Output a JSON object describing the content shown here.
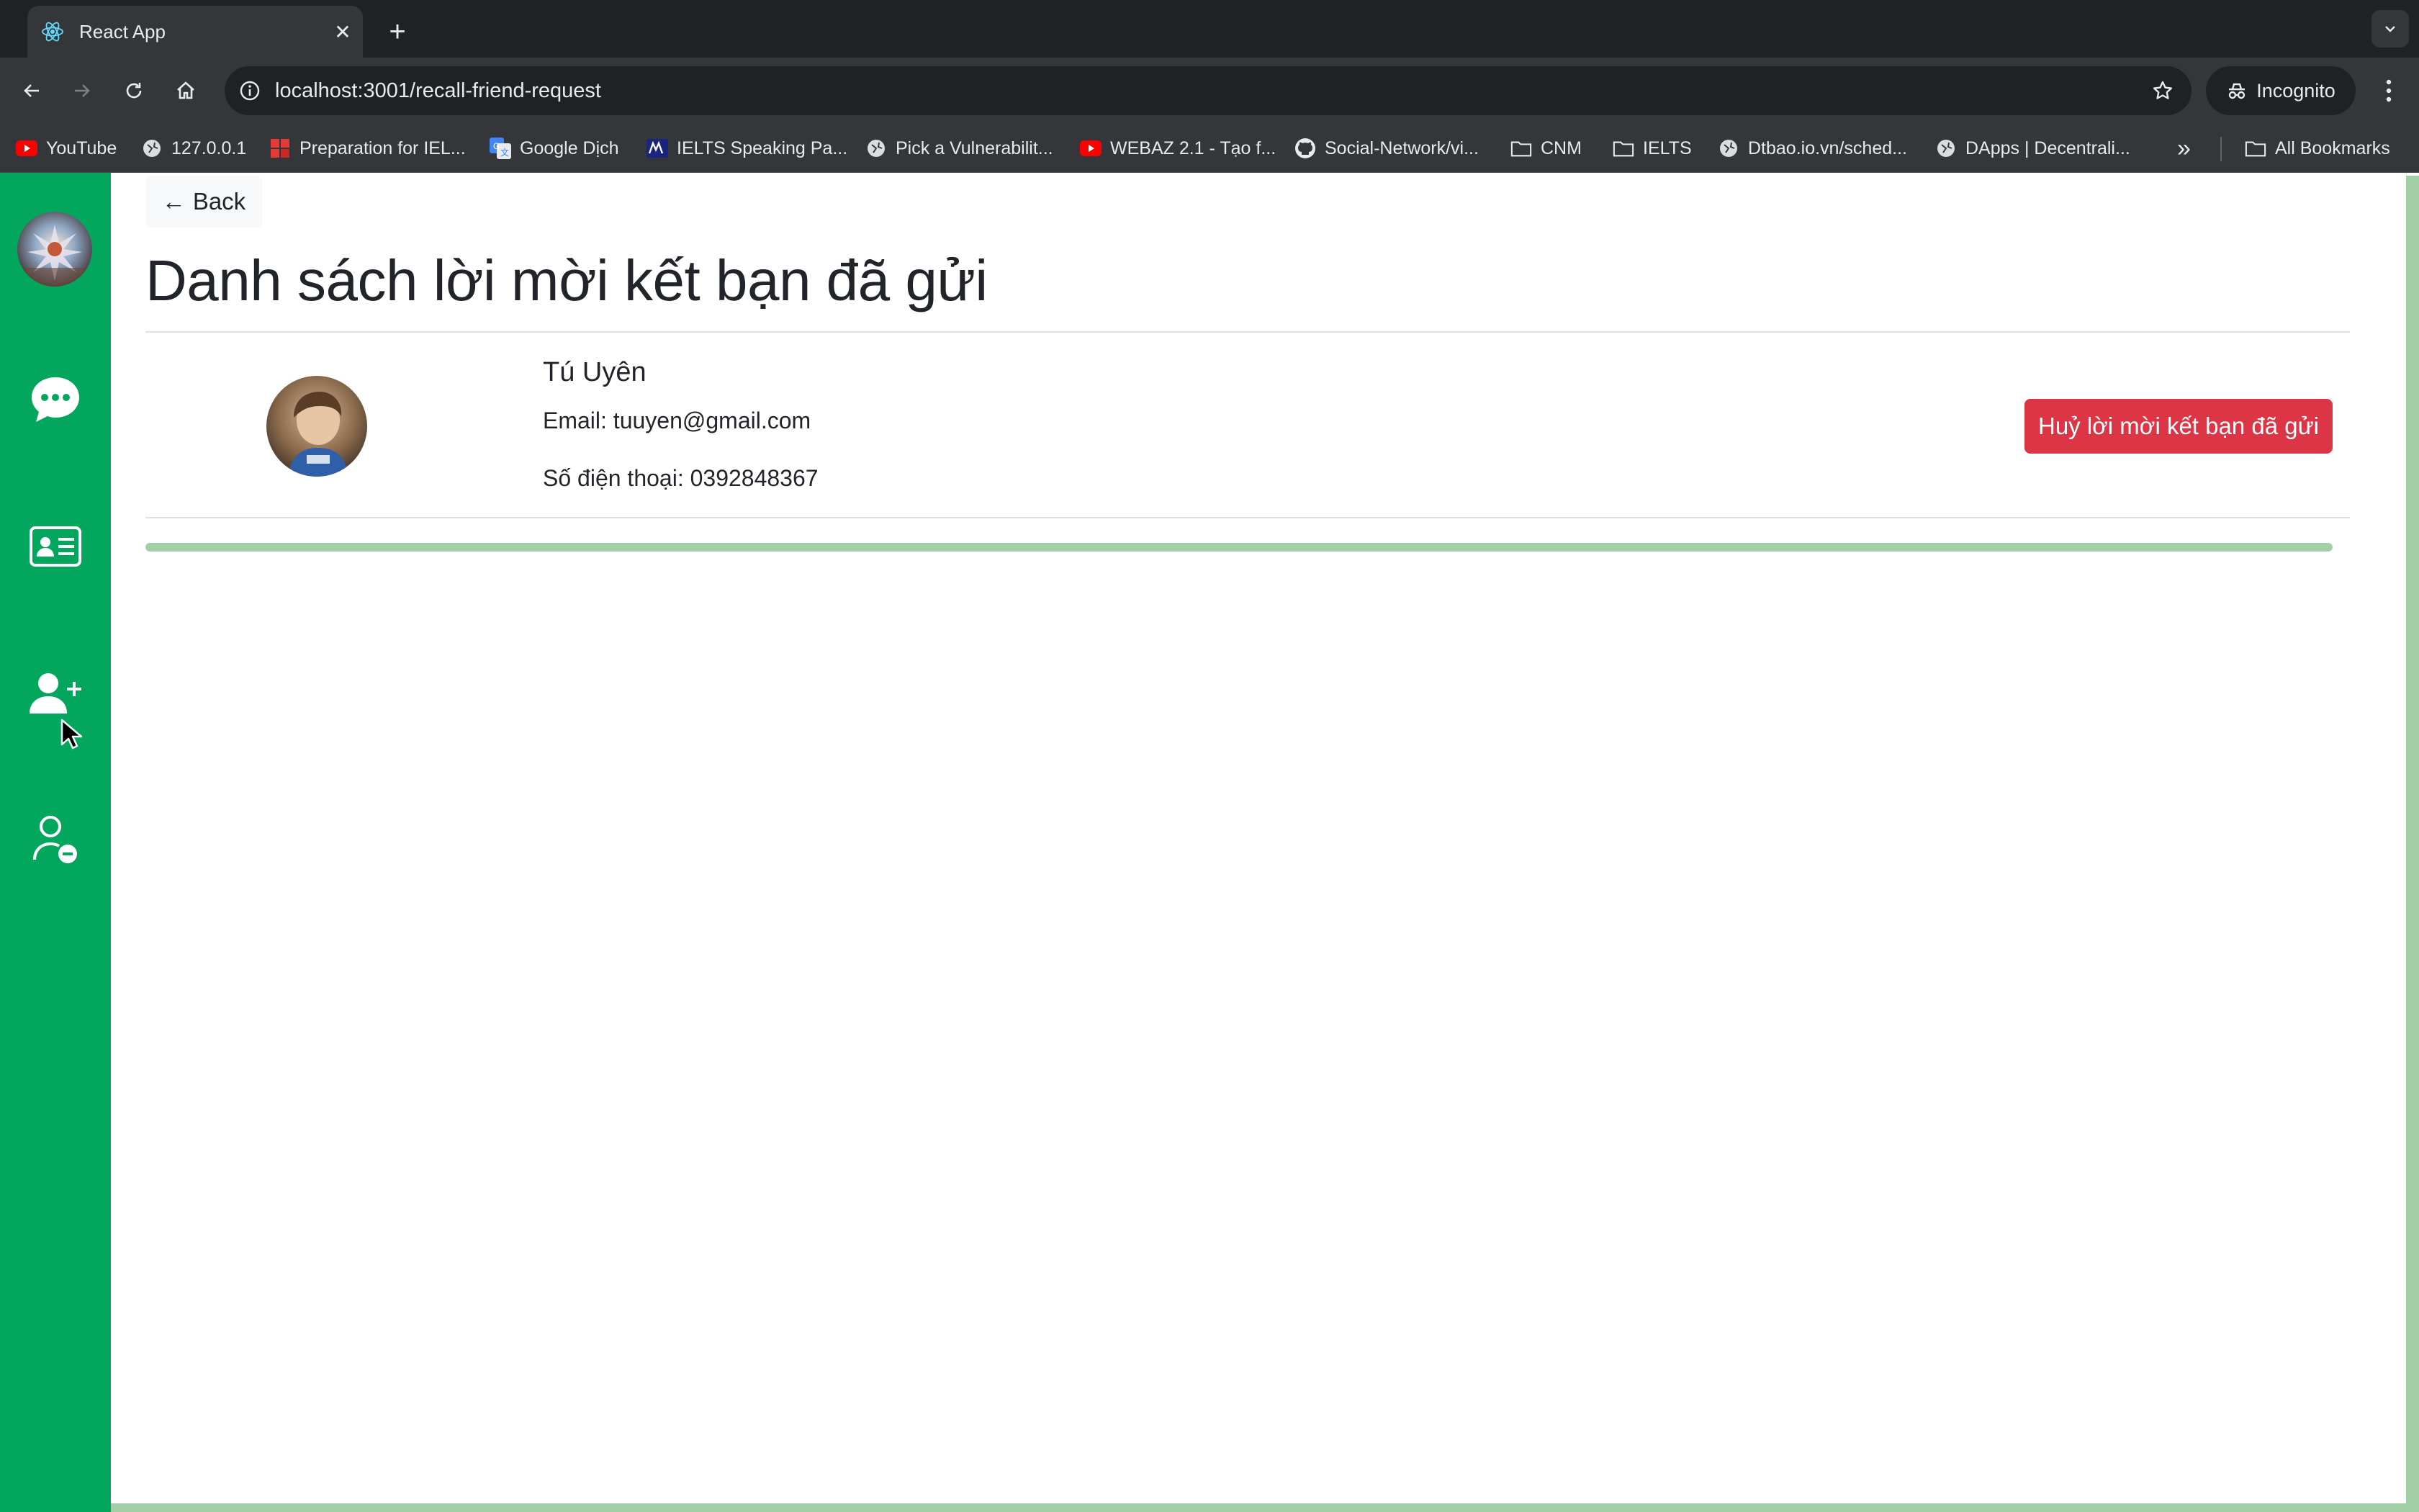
{
  "browser": {
    "tab_title": "React App",
    "close_glyph": "✕",
    "new_tab_glyph": "+",
    "url": "localhost:3001/recall-friend-request",
    "incognito_label": "Incognito"
  },
  "bookmarks": [
    {
      "label": "YouTube",
      "icon": "youtube-icon"
    },
    {
      "label": "127.0.0.1",
      "icon": "globe-icon"
    },
    {
      "label": "Preparation for IEL...",
      "icon": "grid-icon"
    },
    {
      "label": "Google Dịch",
      "icon": "translate-icon"
    },
    {
      "label": "IELTS Speaking Pa...",
      "icon": "ielts-icon"
    },
    {
      "label": "Pick a Vulnerabilit...",
      "icon": "globe-icon"
    },
    {
      "label": "WEBAZ 2.1 - Tạo f...",
      "icon": "youtube-icon"
    },
    {
      "label": "Social-Network/vi...",
      "icon": "github-icon"
    },
    {
      "label": "CNM",
      "icon": "folder-icon"
    },
    {
      "label": "IELTS",
      "icon": "folder-icon"
    },
    {
      "label": "Dtbao.io.vn/sched...",
      "icon": "globe-icon"
    },
    {
      "label": "DApps | Decentrali...",
      "icon": "globe-icon"
    }
  ],
  "bookmarks_overflow": "»",
  "all_bookmarks_label": "All Bookmarks",
  "sidebar": {
    "items": [
      {
        "name": "chat",
        "icon": "chat-bubble-icon"
      },
      {
        "name": "contacts",
        "icon": "contact-card-icon"
      },
      {
        "name": "add-friend",
        "icon": "person-add-icon"
      },
      {
        "name": "remove-friend",
        "icon": "person-remove-icon"
      }
    ]
  },
  "page": {
    "back_label": "Back",
    "back_arrow": "←",
    "title": "Danh sách lời mời kết bạn đã gửi",
    "request": {
      "name": "Tú Uyên",
      "email_line": "Email: tuuyen@gmail.com",
      "phone_line": "Số điện thoại: 0392848367",
      "cancel_label": "Huỷ lời mời kết bạn đã gửi"
    },
    "progress_fraction": 1.0
  },
  "colors": {
    "sidebar": "#02a65c",
    "danger": "#dc3545",
    "progress": "#a3cfa7"
  }
}
